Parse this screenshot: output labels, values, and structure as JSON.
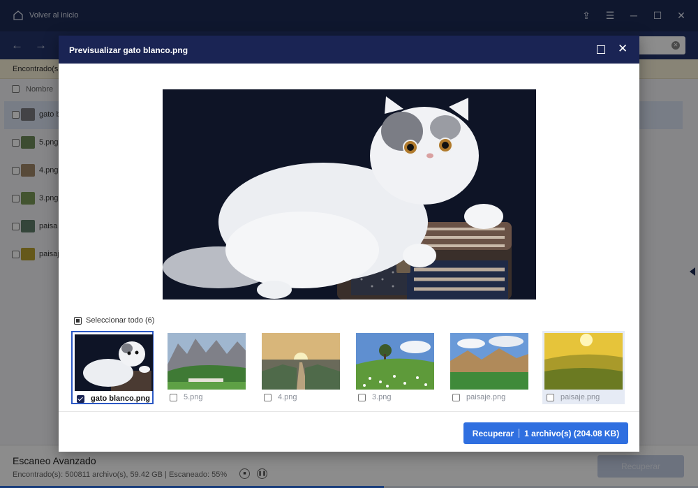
{
  "app": {
    "title": "Volver al inicio",
    "found_label": "Encontrado(s)",
    "column_name": "Nombre",
    "files": [
      {
        "name": "gato b",
        "color": "#7b7b80"
      },
      {
        "name": "5.png",
        "color": "#6e8a5a"
      },
      {
        "name": "4.png",
        "color": "#a08868"
      },
      {
        "name": "3.png",
        "color": "#7a9a58"
      },
      {
        "name": "paisa",
        "color": "#5f7f6a"
      },
      {
        "name": "paisaje",
        "color": "#b8a030"
      }
    ],
    "scan_title": "Escaneo Avanzado",
    "scan_stats": "Encontrado(s): 500811 archivo(s), 59.42 GB | Escaneado: 55%",
    "recover_label": "Recuperar",
    "scan_progress": 0.55
  },
  "modal": {
    "title": "Previsualizar gato blanco.png",
    "select_all": "Seleccionar todo (6)",
    "thumbnails": [
      {
        "name": "gato blanco.png",
        "selected": true
      },
      {
        "name": "5.png",
        "selected": false
      },
      {
        "name": "4.png",
        "selected": false
      },
      {
        "name": "3.png",
        "selected": false
      },
      {
        "name": "paisaje.png",
        "selected": false
      },
      {
        "name": "paisaje.png",
        "selected": false
      }
    ],
    "recover_button": {
      "label": "Recuperar",
      "detail": "1 archivo(s) (204.08 KB)"
    }
  },
  "colors": {
    "header": "#1a2454",
    "accent": "#2f6fe0"
  }
}
